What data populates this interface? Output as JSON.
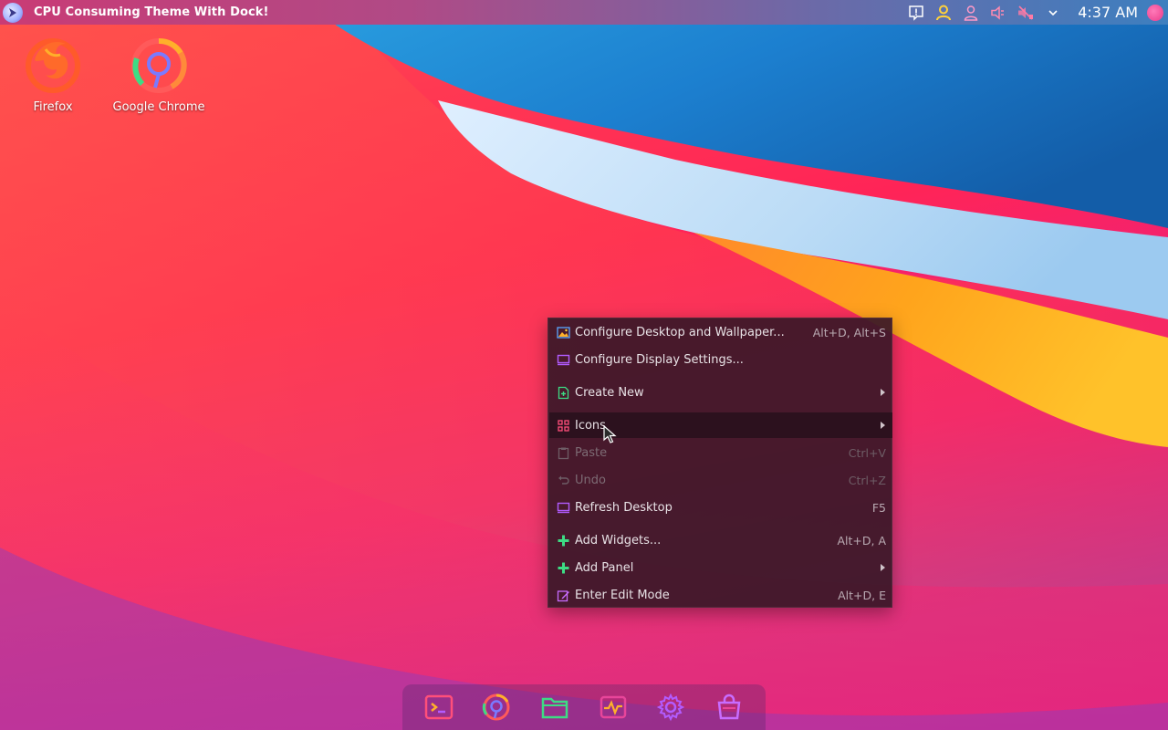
{
  "panel": {
    "title": "CPU Consuming Theme With Dock!",
    "clock": "4:37 AM",
    "tray_icons": [
      "notification-icon",
      "user-yellow-icon",
      "user-pink-icon",
      "volume-icon",
      "volume-muted-icon",
      "chevron-down-icon"
    ]
  },
  "desktop_icons": [
    {
      "label": "Firefox",
      "icon": "firefox-icon"
    },
    {
      "label": "Google Chrome",
      "icon": "chrome-icon"
    }
  ],
  "context_menu": {
    "items": [
      {
        "label": "Configure Desktop and Wallpaper...",
        "shortcut": "Alt+D, Alt+S",
        "icon": "wallpaper-icon",
        "enabled": true
      },
      {
        "label": "Configure Display Settings...",
        "shortcut": "",
        "icon": "display-icon",
        "enabled": true
      },
      {
        "label": "Create New",
        "shortcut": "",
        "icon": "create-new-icon",
        "enabled": true,
        "submenu": true
      },
      {
        "label": "Icons",
        "shortcut": "",
        "icon": "grid-icon",
        "enabled": true,
        "submenu": true,
        "highlighted": true
      },
      {
        "label": "Paste",
        "shortcut": "Ctrl+V",
        "icon": "paste-icon",
        "enabled": false
      },
      {
        "label": "Undo",
        "shortcut": "Ctrl+Z",
        "icon": "undo-icon",
        "enabled": false
      },
      {
        "label": "Refresh Desktop",
        "shortcut": "F5",
        "icon": "refresh-display-icon",
        "enabled": true
      },
      {
        "label": "Add Widgets...",
        "shortcut": "Alt+D, A",
        "icon": "plus-icon",
        "enabled": true
      },
      {
        "label": "Add Panel",
        "shortcut": "",
        "icon": "plus-icon",
        "enabled": true,
        "submenu": true
      },
      {
        "label": "Enter Edit Mode",
        "shortcut": "Alt+D, E",
        "icon": "edit-icon",
        "enabled": true
      }
    ]
  },
  "dock": {
    "items": [
      "terminal-icon",
      "chrome-icon",
      "folder-icon",
      "system-monitor-icon",
      "settings-gear-icon",
      "store-bag-icon"
    ]
  },
  "colors": {
    "menu_bg": "#3a1828",
    "accent_pink": "#e8459a",
    "accent_green": "#3ddc84",
    "accent_purple": "#b25cff"
  }
}
